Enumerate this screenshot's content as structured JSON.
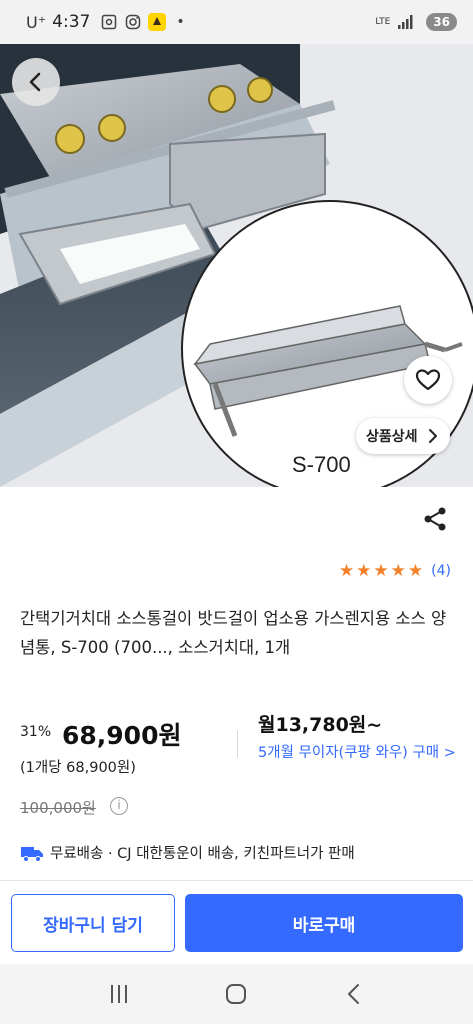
{
  "status_bar": {
    "carrier": "U⁺",
    "time": "4:37",
    "network": "LTE",
    "battery": "36"
  },
  "product_image": {
    "model_label": "S-700"
  },
  "buttons": {
    "detail_label": "상품상세"
  },
  "product": {
    "rating_count": "(4)",
    "rating_stars": 5,
    "title": "간택기거치대 소스통걸이 밧드걸이 업소용 가스렌지용 소스 양념통, S-700 (700..., 소스거치대, 1개",
    "discount_rate": "31%",
    "price": "68,900원",
    "unit_price": "(1개당 68,900원)",
    "original_price": "100,000원",
    "monthly_price": "월13,780원~",
    "installment_text": "5개월 무이자(쿠팡 와우) 구매 >",
    "shipping_text": "무료배송 · CJ 대한통운이 배송, 키친파트너가 판매"
  },
  "actions": {
    "cart_label": "장바구니 담기",
    "buy_label": "바로구매"
  },
  "colors": {
    "accent": "#346aff",
    "star": "#f5822a"
  }
}
